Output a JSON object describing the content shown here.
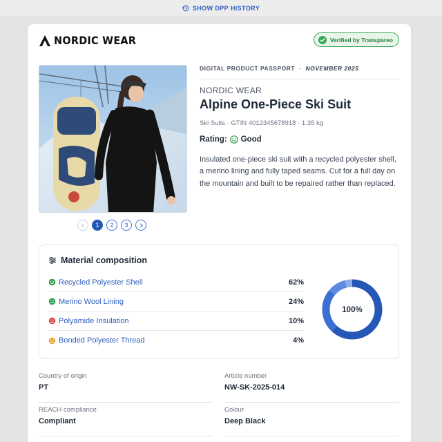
{
  "topbar": {
    "history_label": "SHOW DPP HISTORY"
  },
  "brand": {
    "name": "NORDIC WEAR"
  },
  "verified": {
    "label": "Verified by Transpareo"
  },
  "gallery": {
    "pages": [
      "1",
      "2",
      "3"
    ],
    "active_page": "1"
  },
  "passport": {
    "label": "DIGITAL PRODUCT PASSPORT",
    "separator": "·",
    "date": "NOVEMBER 2025"
  },
  "product": {
    "brand": "NORDIC WEAR",
    "title": "Alpine One-Piece Ski Suit",
    "meta": "Ski Suits · GTIN 4012345678918 · 1.35 kg",
    "rating_label": "Rating:",
    "rating_value": "Good",
    "description": "Insulated one-piece ski suit with a recycled polyester shell, a merino lining and fully taped seams. Cut for a full day on the mountain and built to be repaired rather than replaced."
  },
  "materials": {
    "title": "Material composition",
    "items": [
      {
        "name": "Recycled Polyester Shell",
        "percent": "62%",
        "share": 62,
        "rating": "good",
        "color": "#2a9d4b"
      },
      {
        "name": "Merino Wool Lining",
        "percent": "24%",
        "share": 24,
        "rating": "good",
        "color": "#2a9d4b"
      },
      {
        "name": "Polyamide Insulation",
        "percent": "10%",
        "share": 10,
        "rating": "bad",
        "color": "#d64545"
      },
      {
        "name": "Bonded Polyester Thread",
        "percent": "4%",
        "share": 4,
        "rating": "medium",
        "color": "#e8a93a"
      }
    ],
    "total_label": "100%",
    "donut_colors": [
      "#2557b7",
      "#3b6fd4",
      "#5b8ae0",
      "#8aaeea"
    ]
  },
  "attributes": [
    {
      "label": "Country of origin",
      "value": "PT"
    },
    {
      "label": "Article number",
      "value": "NW-SK-2025-014"
    },
    {
      "label": "REACH compliance",
      "value": "Compliant"
    },
    {
      "label": "Colour",
      "value": "Deep Black"
    }
  ]
}
